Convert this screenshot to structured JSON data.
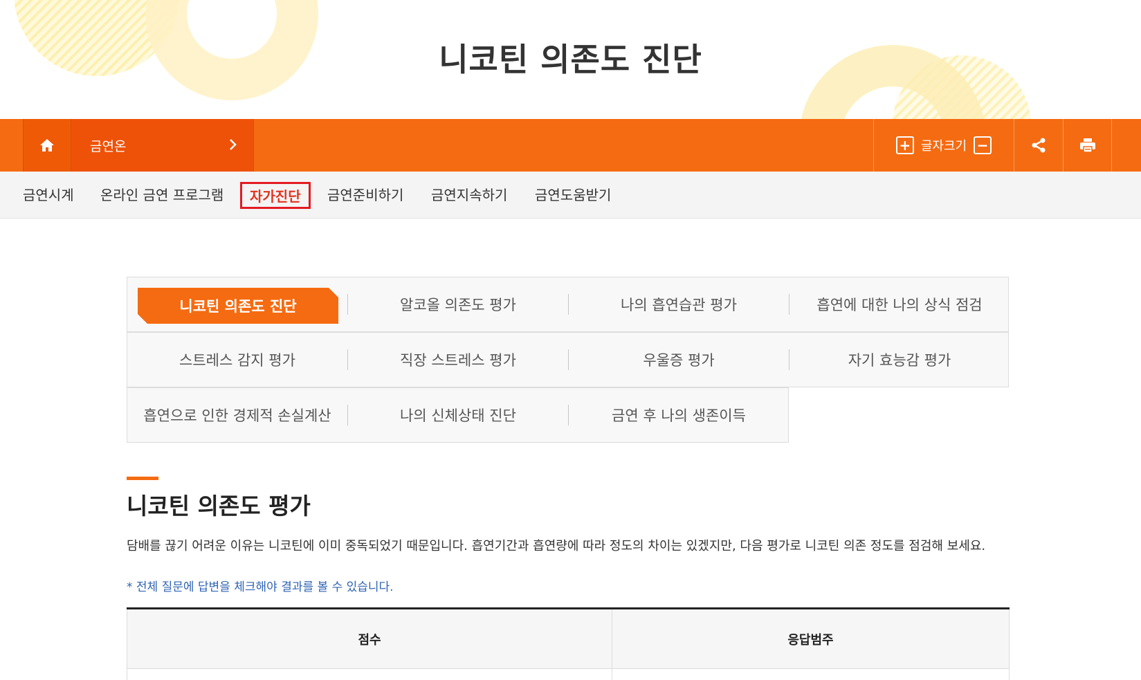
{
  "header": {
    "title": "니코틴 의존도 진단"
  },
  "topbar": {
    "home_icon": "home-icon",
    "site_label": "금연온",
    "font_size_label": "글자크기",
    "font_increase": "+",
    "font_decrease": "−",
    "share_icon": "share-icon",
    "print_icon": "print-icon",
    "colors": {
      "bar": "#f56b11",
      "dark": "#ee5208"
    }
  },
  "subnav": {
    "items": [
      "금연시계",
      "온라인 금연 프로그램",
      "자가진단",
      "금연준비하기",
      "금연지속하기",
      "금연도움받기"
    ],
    "active": "자가진단"
  },
  "tabs": {
    "rows": [
      [
        "니코틴 의존도 진단",
        "알코올 의존도 평가",
        "나의 흡연습관 평가",
        "흡연에 대한 나의 상식 점검"
      ],
      [
        "스트레스 감지 평가",
        "직장 스트레스 평가",
        "우울증 평가",
        "자기 효능감 평가"
      ],
      [
        "흡연으로 인한 경제적 손실계산",
        "나의 신체상태 진단",
        "금연 후 나의 생존이득"
      ]
    ],
    "active": "니코틴 의존도 진단"
  },
  "content": {
    "section_title": "니코틴 의존도 평가",
    "description": "담배를 끊기 어려운 이유는 니코틴에 이미 중독되었기 때문입니다. 흡연기간과 흡연량에 따라 정도의 차이는 있겠지만, 다음 평가로 니코틴 의존 정도를 점검해 보세요.",
    "note": "* 전체 질문에 답변을 체크해야 결과를 볼 수 있습니다.",
    "table": {
      "headers": [
        "점수",
        "응답범주"
      ]
    }
  }
}
